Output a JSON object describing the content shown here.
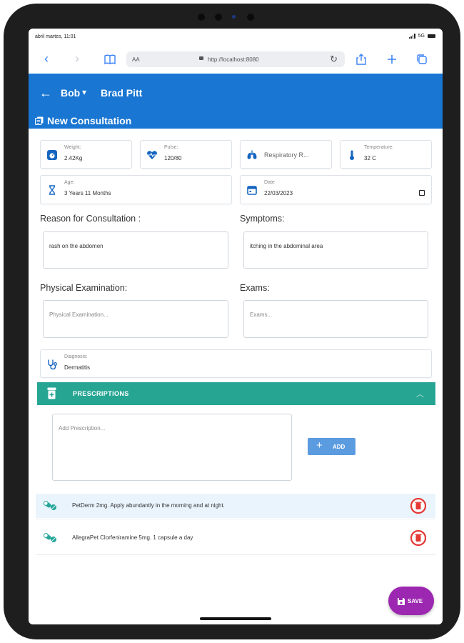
{
  "status_bar": {
    "time": "abril martes, 11:01",
    "network": "5G"
  },
  "browser": {
    "text_size_label": "AA",
    "url": "http://localhost:8080"
  },
  "header": {
    "pet_name": "Bob",
    "owner_name": "Brad Pitt",
    "section_title": "New Consultation"
  },
  "vitals": {
    "weight": {
      "label": "Weight:",
      "value": "2.42Kg"
    },
    "pulse": {
      "label": "Pulse:",
      "value": "120/80"
    },
    "respiratory": {
      "placeholder": "Respiratory R..."
    },
    "temperature": {
      "label": "Temperature:",
      "value": "32 C"
    },
    "age": {
      "label": "Age:",
      "value": "3 Years 11 Months"
    },
    "date": {
      "label": "Date",
      "value": "22/03/2023"
    }
  },
  "reason": {
    "label": "Reason for Consultation :",
    "value": "rash on the abdomen"
  },
  "symptoms": {
    "label": "Symptoms:",
    "value": "itching in the abdominal area"
  },
  "physical_exam": {
    "label": "Physical Examination:",
    "placeholder": "Physical Examination..."
  },
  "exams": {
    "label": "Exams:",
    "placeholder": "Exams..."
  },
  "diagnosis": {
    "label": "Diagnosis:",
    "value": "Dermatitis"
  },
  "prescriptions": {
    "title": "PRESCRIPTIONS",
    "input_placeholder": "Add Prescription...",
    "add_label": "ADD",
    "items": [
      {
        "text": "PetDerm 2mg. Apply abundantly in the morning and at night."
      },
      {
        "text": "AllegraPet Clorfeniramine 5mg. 1 capsule a day"
      }
    ]
  },
  "save_label": "SAVE",
  "colors": {
    "header": "#1976d2",
    "prescriptions_bar": "#27a593",
    "add_button": "#5b9be0",
    "save_button": "#9c27b0",
    "delete_icon": "#e53935",
    "icon_blue": "#1565c0",
    "pill_icon": "#26a69a"
  }
}
